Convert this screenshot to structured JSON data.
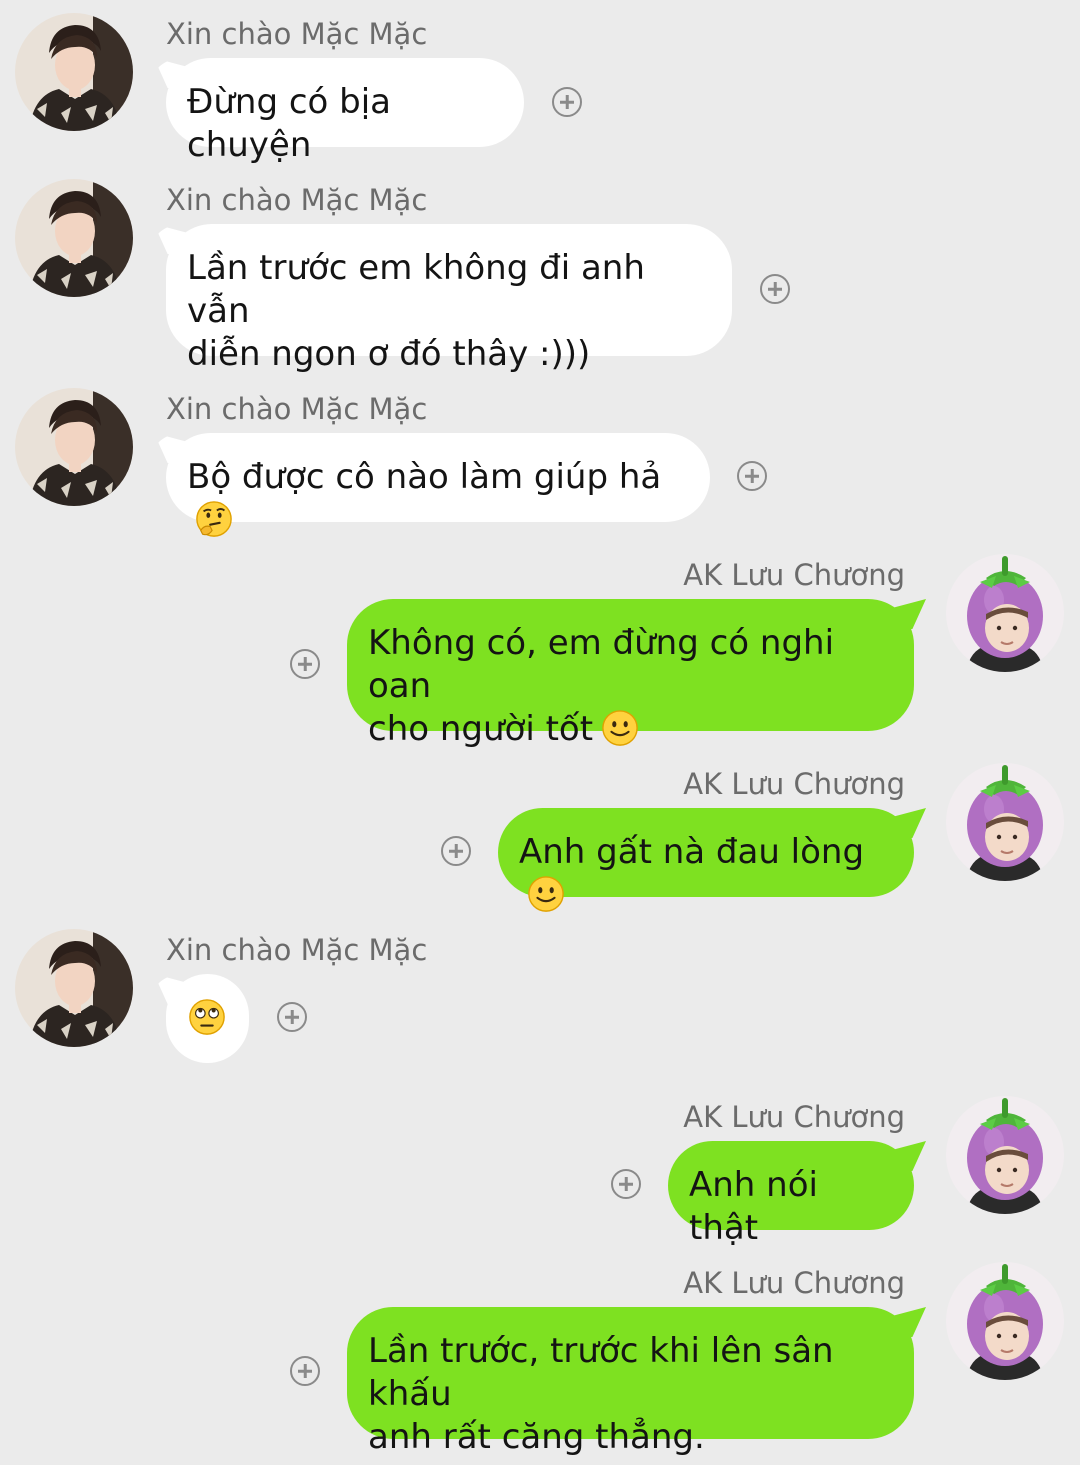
{
  "contacts": {
    "other": {
      "name": "Xin chào Mặc Mặc",
      "avatar_icon": "portrait-avatar-icon"
    },
    "me": {
      "name": "AK Lưu Chương",
      "avatar_icon": "eggplant-hat-avatar-icon"
    }
  },
  "colors": {
    "background": "#ebebeb",
    "incoming_bubble": "#ffffff",
    "outgoing_bubble": "#7ee121",
    "name_text": "#6b6b6b"
  },
  "messages": [
    {
      "sender": "Xin chào Mặc Mặc",
      "direction": "incoming",
      "lines": [
        "Đừng có bịa chuyện"
      ],
      "emoji": ""
    },
    {
      "sender": "Xin chào Mặc Mặc",
      "direction": "incoming",
      "lines": [
        "Lần trước em không đi anh vẫn",
        "diễn ngon ơ đó thây :)))"
      ],
      "emoji": ""
    },
    {
      "sender": "Xin chào Mặc Mặc",
      "direction": "incoming",
      "lines": [
        "Bộ được cô nào làm giúp hả"
      ],
      "emoji": "thinking-face-emoji"
    },
    {
      "sender": "AK Lưu Chương",
      "direction": "outgoing",
      "lines": [
        "Không có, em đừng có nghi oan",
        "cho người tốt"
      ],
      "emoji": "slight-smile-emoji"
    },
    {
      "sender": "AK Lưu Chương",
      "direction": "outgoing",
      "lines": [
        "Anh gất nà đau lòng"
      ],
      "emoji": "slight-smile-emoji"
    },
    {
      "sender": "Xin chào Mặc Mặc",
      "direction": "incoming",
      "lines": [],
      "emoji": "eye-roll-emoji"
    },
    {
      "sender": "AK Lưu Chương",
      "direction": "outgoing",
      "lines": [
        "Anh nói thật"
      ],
      "emoji": ""
    },
    {
      "sender": "AK Lưu Chương",
      "direction": "outgoing",
      "lines": [
        "Lần trước, trước khi lên sân khấu",
        "anh rất căng thẳng."
      ],
      "emoji": ""
    }
  ]
}
